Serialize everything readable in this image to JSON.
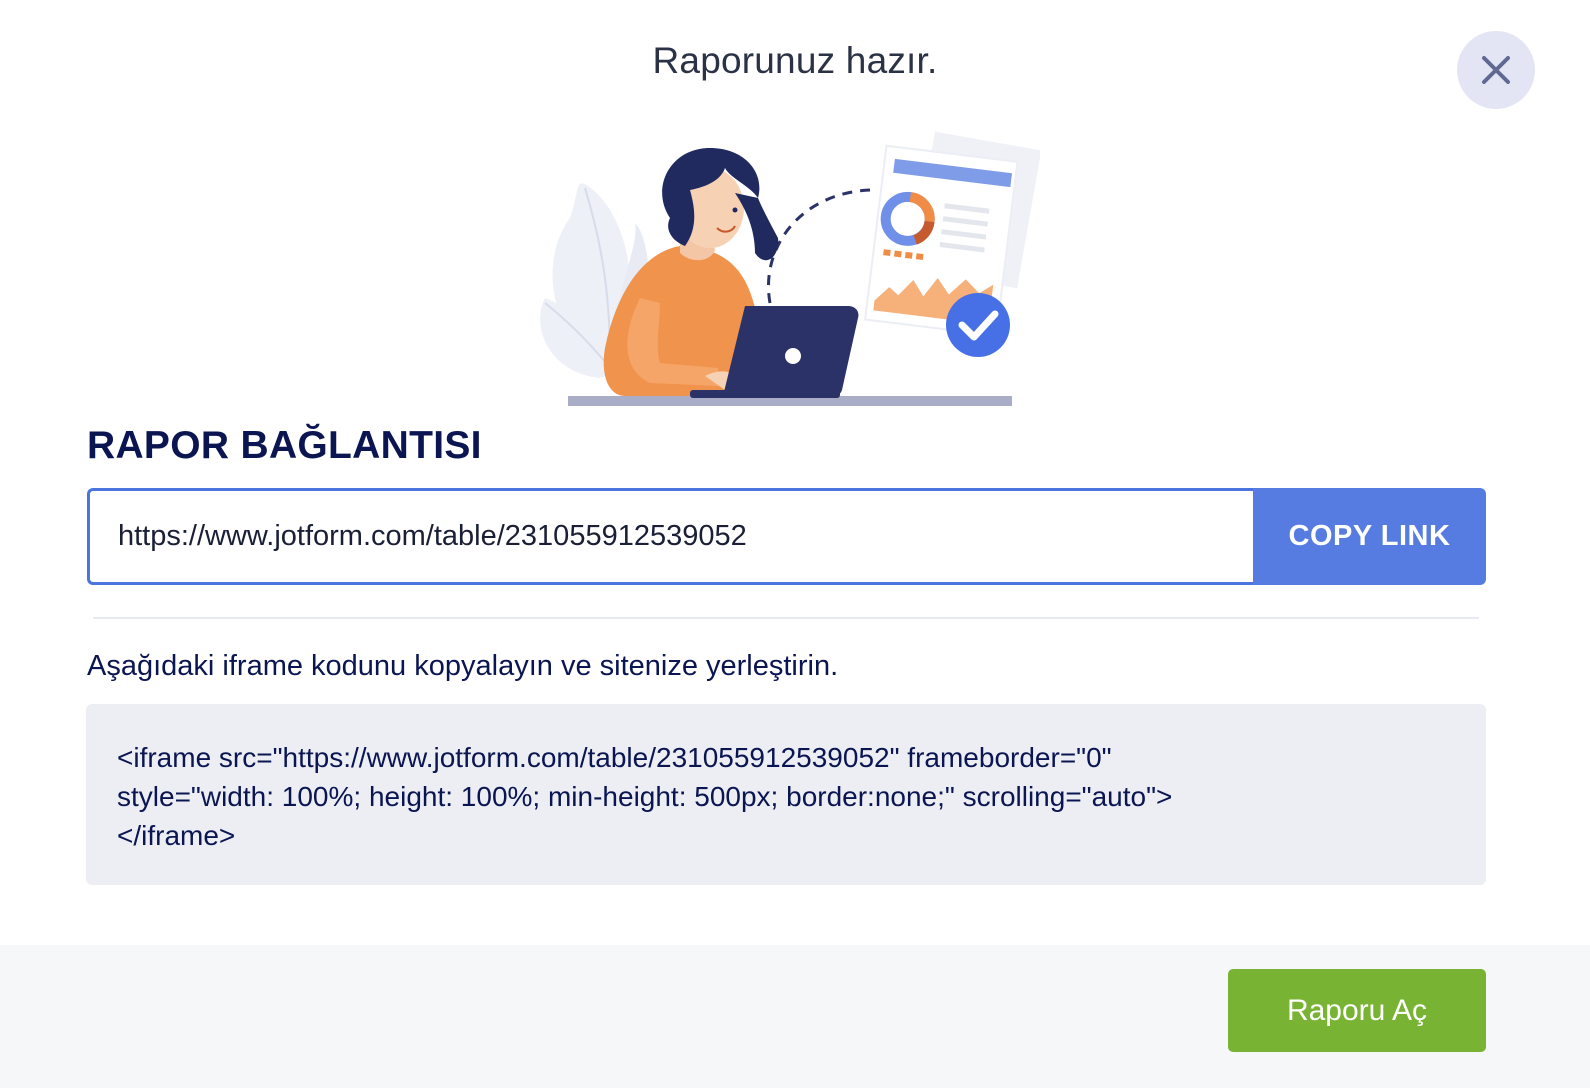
{
  "modal": {
    "title": "Raporunuz hazır.",
    "close_icon": "close-icon"
  },
  "illustration": {
    "name": "woman-with-laptop-report-illustration",
    "colors": {
      "accent_blue": "#567ce1",
      "orange": "#f08c45",
      "navy": "#2b3267"
    }
  },
  "report_link": {
    "section_title": "RAPOR BAĞLANTISI",
    "url": "https://www.jotform.com/table/231055912539052",
    "copy_label": "COPY LINK"
  },
  "embed": {
    "instruction": "Aşağıdaki iframe kodunu kopyalayın ve sitenize yerleştirin.",
    "code": "<iframe src=\"https://www.jotform.com/table/231055912539052\" frameborder=\"0\"\nstyle=\"width: 100%; height: 100%; min-height: 500px; border:none;\" scrolling=\"auto\">\n</iframe>"
  },
  "footer": {
    "open_report_label": "Raporu Aç"
  },
  "colors": {
    "primary_blue": "#567ce1",
    "input_border": "#4c74de",
    "green": "#78b334",
    "close_bg": "#e3e5f5",
    "code_bg": "#eceef4",
    "footer_bg": "#f6f7f9",
    "heading": "#0a1551"
  }
}
